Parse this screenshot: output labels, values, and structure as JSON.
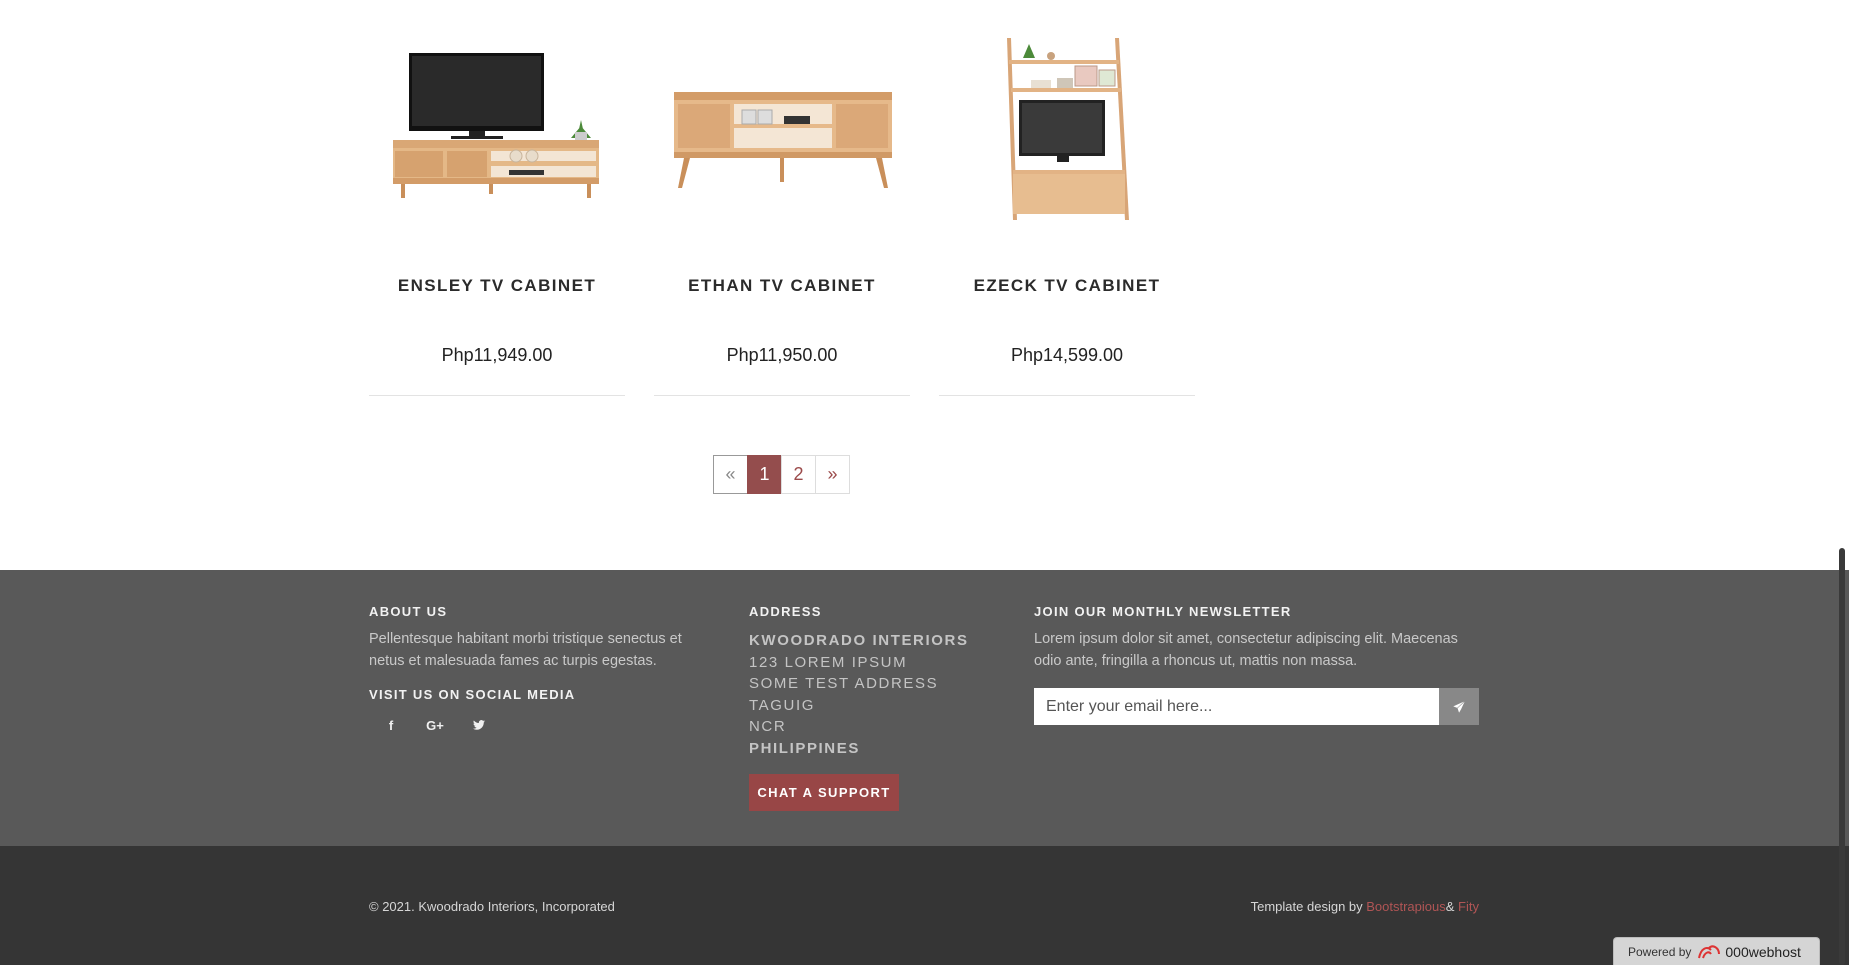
{
  "products": [
    {
      "name": "ENSLEY TV CABINET",
      "price": "Php11,949.00",
      "image": "tv-cabinet-with-tv-image"
    },
    {
      "name": "ETHAN TV CABINET",
      "price": "Php11,950.00",
      "image": "tv-cabinet-image"
    },
    {
      "name": "EZECK TV CABINET",
      "price": "Php14,599.00",
      "image": "ladder-shelf-tv-cabinet-image"
    }
  ],
  "pagination": {
    "prev": "«",
    "pages": [
      "1",
      "2"
    ],
    "active": "1",
    "next": "»"
  },
  "footer": {
    "about_title": "ABOUT US",
    "about_text": "Pellentesque habitant morbi tristique senectus et netus et malesuada fames ac turpis egestas.",
    "social_title": "VISIT US ON SOCIAL MEDIA",
    "social_icons": [
      "f",
      "G+",
      "t"
    ],
    "address_title": "ADDRESS",
    "address_lines": [
      "KWOODRADO INTERIORS",
      "123 LOREM IPSUM",
      "SOME TEST ADDRESS",
      "TAGUIG",
      "NCR",
      "PHILIPPINES"
    ],
    "chat_button": "CHAT A SUPPORT",
    "newsletter_title": "JOIN OUR MONTHLY NEWSLETTER",
    "newsletter_text": "Lorem ipsum dolor sit amet, consectetur adipiscing elit. Maecenas odio ante, fringilla a rhoncus ut, mattis non massa.",
    "email_placeholder": "Enter your email here...",
    "copyright": "© 2021. Kwoodrado Interiors, Incorporated",
    "credit_prefix": "Template design by ",
    "credit_link1": "Bootstrapious",
    "credit_amp": "& ",
    "credit_link2": "Fity"
  },
  "powered": {
    "label": "Powered by",
    "brand": "000webhost"
  },
  "colors": {
    "accent": "#944d4d",
    "footer_top": "#595959",
    "footer_bottom": "#353535"
  }
}
